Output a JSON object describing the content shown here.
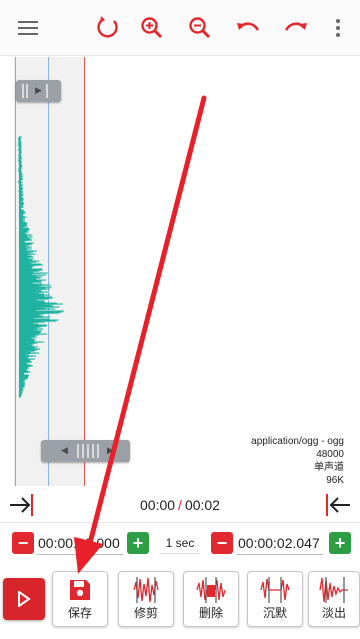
{
  "toolbar": {
    "icons": [
      "menu-icon",
      "refresh-icon",
      "zoom-in-icon",
      "zoom-out-icon",
      "undo-icon",
      "redo-icon",
      "more-vert-icon"
    ],
    "accent": "#e0282e"
  },
  "audio_info": {
    "format": "application/ogg - ogg",
    "sample_rate": "48000",
    "channels": "单声道",
    "bitrate": "96K"
  },
  "timeline": {
    "current": "00:00",
    "separator": "/",
    "total": "00:02"
  },
  "range": {
    "start": "00:00:00.000",
    "step": "1 sec",
    "end": "00:00:02.047"
  },
  "tools": [
    {
      "label": "保存",
      "icon": "save-icon"
    },
    {
      "label": "修剪",
      "icon": "trim-icon"
    },
    {
      "label": "删除",
      "icon": "delete-icon"
    },
    {
      "label": "沉默",
      "icon": "silence-icon"
    },
    {
      "label": "淡出",
      "icon": "fade-out-icon"
    }
  ],
  "colors": {
    "waveform": "#1fb3a0",
    "red": "#e0282e",
    "green": "#2e9e45"
  }
}
